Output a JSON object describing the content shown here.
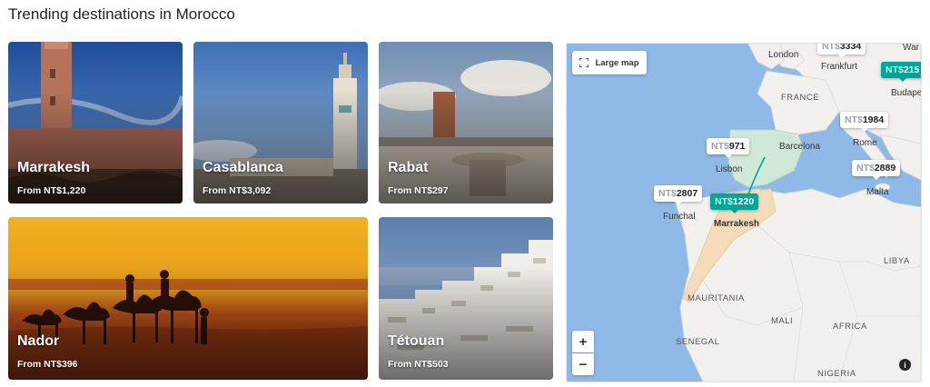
{
  "section": {
    "title": "Trending destinations in Morocco"
  },
  "destinations": [
    {
      "city": "Marrakesh",
      "price": "From NT$1,220"
    },
    {
      "city": "Casablanca",
      "price": "From NT$3,092"
    },
    {
      "city": "Rabat",
      "price": "From NT$297"
    },
    {
      "city": "Nador",
      "price": "From NT$396"
    },
    {
      "city": "Tétouan",
      "price": "From NT$503"
    }
  ],
  "map": {
    "large_map_label": "Large map",
    "zoom_in": "+",
    "zoom_out": "−",
    "info": "i",
    "pins": [
      {
        "currency": "NT$",
        "amount": "3334"
      },
      {
        "currency": "NT$",
        "amount": "215"
      },
      {
        "currency": "NT$",
        "amount": "971"
      },
      {
        "currency": "NT$",
        "amount": "1984"
      },
      {
        "currency": "NT$",
        "amount": "2889"
      },
      {
        "currency": "NT$",
        "amount": "2807"
      },
      {
        "currency": "NT$",
        "amount": "1220"
      }
    ],
    "labels": {
      "london": "London",
      "frankfurt": "Frankfurt",
      "warsaw": "War",
      "budapest": "Budapes",
      "france": "FRANCE",
      "barcelona": "Barcelona",
      "rome": "Rome",
      "lisbon": "Lisbon",
      "malta": "Malta",
      "funchal": "Funchal",
      "marrakesh": "Marrakesh",
      "libya": "LIBYA",
      "mauritania": "MAURITANIA",
      "mali": "MALI",
      "africa": "AFRICA",
      "senegal": "SENEGAL",
      "nigeria": "NIGERIA"
    },
    "colors": {
      "water": "#8fb9e6",
      "land": "#f2f1ee",
      "spain": "#cfe8d8",
      "morocco": "#f4dcb8",
      "accent": "#00a698"
    }
  }
}
